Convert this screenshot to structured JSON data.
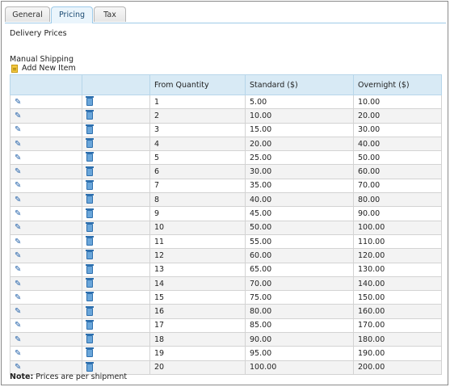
{
  "tabs": [
    {
      "label": "General"
    },
    {
      "label": "Pricing"
    },
    {
      "label": "Tax"
    }
  ],
  "section": {
    "title": "Delivery Prices",
    "subtitle": "Manual Shipping",
    "add_new_label": "Add New Item"
  },
  "table": {
    "headers": [
      "",
      "",
      "From Quantity",
      "Standard ($)",
      "Overnight ($)"
    ],
    "rows": [
      {
        "qty": "1",
        "standard": "5.00",
        "overnight": "10.00"
      },
      {
        "qty": "2",
        "standard": "10.00",
        "overnight": "20.00"
      },
      {
        "qty": "3",
        "standard": "15.00",
        "overnight": "30.00"
      },
      {
        "qty": "4",
        "standard": "20.00",
        "overnight": "40.00"
      },
      {
        "qty": "5",
        "standard": "25.00",
        "overnight": "50.00"
      },
      {
        "qty": "6",
        "standard": "30.00",
        "overnight": "60.00"
      },
      {
        "qty": "7",
        "standard": "35.00",
        "overnight": "70.00"
      },
      {
        "qty": "8",
        "standard": "40.00",
        "overnight": "80.00"
      },
      {
        "qty": "9",
        "standard": "45.00",
        "overnight": "90.00"
      },
      {
        "qty": "10",
        "standard": "50.00",
        "overnight": "100.00"
      },
      {
        "qty": "11",
        "standard": "55.00",
        "overnight": "110.00"
      },
      {
        "qty": "12",
        "standard": "60.00",
        "overnight": "120.00"
      },
      {
        "qty": "13",
        "standard": "65.00",
        "overnight": "130.00"
      },
      {
        "qty": "14",
        "standard": "70.00",
        "overnight": "140.00"
      },
      {
        "qty": "15",
        "standard": "75.00",
        "overnight": "150.00"
      },
      {
        "qty": "16",
        "standard": "80.00",
        "overnight": "160.00"
      },
      {
        "qty": "17",
        "standard": "85.00",
        "overnight": "170.00"
      },
      {
        "qty": "18",
        "standard": "90.00",
        "overnight": "180.00"
      },
      {
        "qty": "19",
        "standard": "95.00",
        "overnight": "190.00"
      },
      {
        "qty": "20",
        "standard": "100.00",
        "overnight": "200.00"
      }
    ],
    "edit_icon": "pencil-icon",
    "delete_icon": "trash-icon"
  },
  "note": {
    "label": "Note:",
    "text": " Prices are per shipment"
  },
  "colors": {
    "header_bg": "#d8eaf5",
    "active_tab_bg": "#eaf5fc",
    "icon_blue": "#1e5ea8"
  }
}
